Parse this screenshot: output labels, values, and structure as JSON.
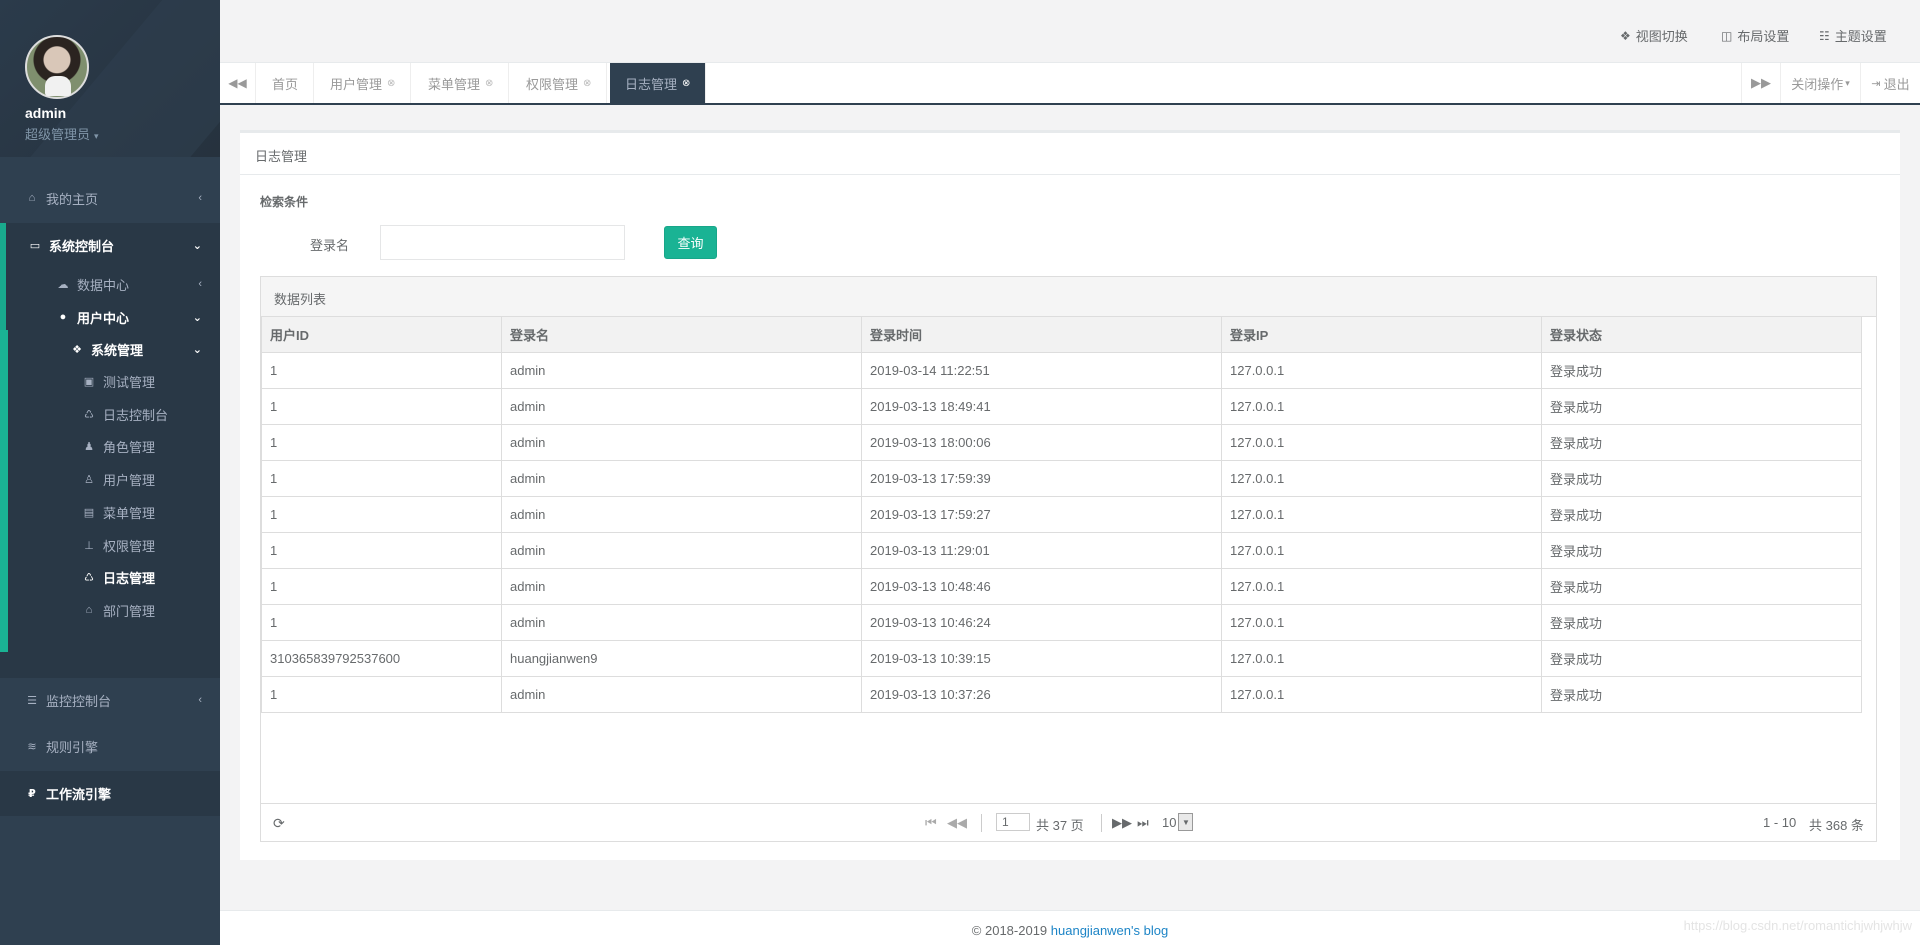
{
  "profile": {
    "name": "admin",
    "role": "超级管理员",
    "role_caret": "▾"
  },
  "sidebar": {
    "items": [
      {
        "label": "我的主页",
        "icon": "home-icon",
        "glyph": "⌂",
        "arrow": "‹"
      },
      {
        "label": "系统控制台",
        "icon": "monitor-icon",
        "glyph": "▭",
        "arrow": "⌄"
      },
      {
        "label": "数据中心",
        "icon": "cloud-icon",
        "glyph": "☁",
        "arrow": "‹"
      },
      {
        "label": "用户中心",
        "icon": "user-icon",
        "glyph": "●",
        "arrow": "⌄"
      },
      {
        "label": "系统管理",
        "icon": "dropbox-icon",
        "glyph": "❖",
        "arrow": "⌄"
      },
      {
        "label": "测试管理",
        "icon": "vimeo-icon",
        "glyph": "▣"
      },
      {
        "label": "日志控制台",
        "icon": "recycle-icon",
        "glyph": "♺"
      },
      {
        "label": "角色管理",
        "icon": "users-icon",
        "glyph": "♟"
      },
      {
        "label": "用户管理",
        "icon": "lock-user-icon",
        "glyph": "♙"
      },
      {
        "label": "菜单管理",
        "icon": "keyboard-icon",
        "glyph": "▤"
      },
      {
        "label": "权限管理",
        "icon": "sitemap-icon",
        "glyph": "⊥"
      },
      {
        "label": "日志管理",
        "icon": "recycle-icon",
        "glyph": "♺"
      },
      {
        "label": "部门管理",
        "icon": "bank-icon",
        "glyph": "⌂"
      },
      {
        "label": "监控控制台",
        "icon": "list-icon",
        "glyph": "☰",
        "arrow": "‹"
      },
      {
        "label": "规则引擎",
        "icon": "database-icon",
        "glyph": "≋"
      },
      {
        "label": "工作流引擎",
        "icon": "ruble-icon",
        "glyph": "₽"
      }
    ]
  },
  "topbar": {
    "view_switch": "视图切换",
    "layout_settings": "布局设置",
    "theme_settings": "主题设置"
  },
  "tabs": {
    "prev": "◀◀",
    "next": "▶▶",
    "items": [
      {
        "label": "首页",
        "close": ""
      },
      {
        "label": "用户管理",
        "close": "⊗"
      },
      {
        "label": "菜单管理",
        "close": "⊗"
      },
      {
        "label": "权限管理",
        "close": "⊗"
      },
      {
        "label": "日志管理",
        "close": "⊗"
      }
    ],
    "close_ops": "关闭操作",
    "close_ops_caret": "▾",
    "logout": "退出"
  },
  "panel": {
    "title": "日志管理",
    "search_title": "检索条件",
    "login_name_label": "登录名",
    "login_name_value": "",
    "query_button": "查询"
  },
  "grid": {
    "title": "数据列表",
    "columns": [
      "用户ID",
      "登录名",
      "登录时间",
      "登录IP",
      "登录状态"
    ],
    "rows": [
      [
        "1",
        "admin",
        "2019-03-14 11:22:51",
        "127.0.0.1",
        "登录成功"
      ],
      [
        "1",
        "admin",
        "2019-03-13 18:49:41",
        "127.0.0.1",
        "登录成功"
      ],
      [
        "1",
        "admin",
        "2019-03-13 18:00:06",
        "127.0.0.1",
        "登录成功"
      ],
      [
        "1",
        "admin",
        "2019-03-13 17:59:39",
        "127.0.0.1",
        "登录成功"
      ],
      [
        "1",
        "admin",
        "2019-03-13 17:59:27",
        "127.0.0.1",
        "登录成功"
      ],
      [
        "1",
        "admin",
        "2019-03-13 11:29:01",
        "127.0.0.1",
        "登录成功"
      ],
      [
        "1",
        "admin",
        "2019-03-13 10:48:46",
        "127.0.0.1",
        "登录成功"
      ],
      [
        "1",
        "admin",
        "2019-03-13 10:46:24",
        "127.0.0.1",
        "登录成功"
      ],
      [
        "310365839792537600",
        "huangjianwen9",
        "2019-03-13 10:39:15",
        "127.0.0.1",
        "登录成功"
      ],
      [
        "1",
        "admin",
        "2019-03-13 10:37:26",
        "127.0.0.1",
        "登录成功"
      ]
    ]
  },
  "pager": {
    "page": "1",
    "total_pages": "共 37 页",
    "page_size": "10",
    "range": "1 - 10",
    "total": "共 368 条"
  },
  "footer": {
    "copyright": "© 2018-2019 ",
    "link": "huangjianwen's blog"
  },
  "watermark": "https://blog.csdn.net/romantichjwhjwhjw",
  "colors": {
    "sidebar": "#2f4050",
    "accent": "#1ab394",
    "link": "#1c84c6"
  }
}
